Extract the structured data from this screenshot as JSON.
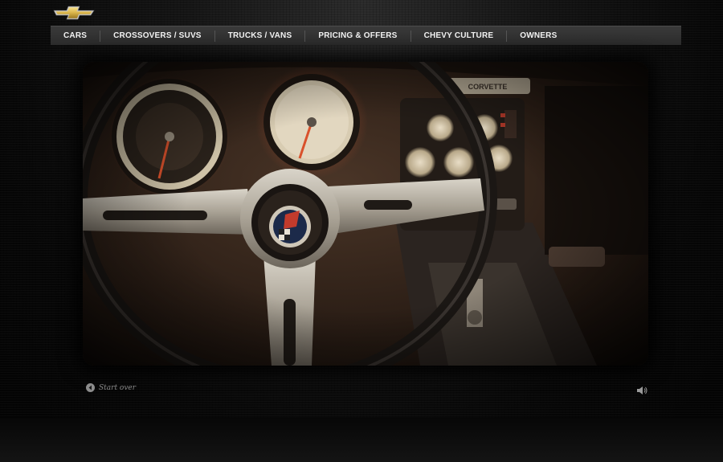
{
  "brand": {
    "logo_icon": "chevrolet-bowtie-logo",
    "accent_color": "#d9b44a"
  },
  "nav": {
    "items": [
      {
        "label": "CARS"
      },
      {
        "label": "CROSSOVERS / SUVS"
      },
      {
        "label": "TRUCKS / VANS"
      },
      {
        "label": "PRICING & OFFERS"
      },
      {
        "label": "CHEVY CULTURE"
      },
      {
        "label": "OWNERS"
      }
    ]
  },
  "video": {
    "dash_badge": "CORVETTE"
  },
  "controls": {
    "start_over_label": "Start over",
    "start_over_icon": "back-arrow-icon",
    "volume_icon": "speaker-icon"
  }
}
